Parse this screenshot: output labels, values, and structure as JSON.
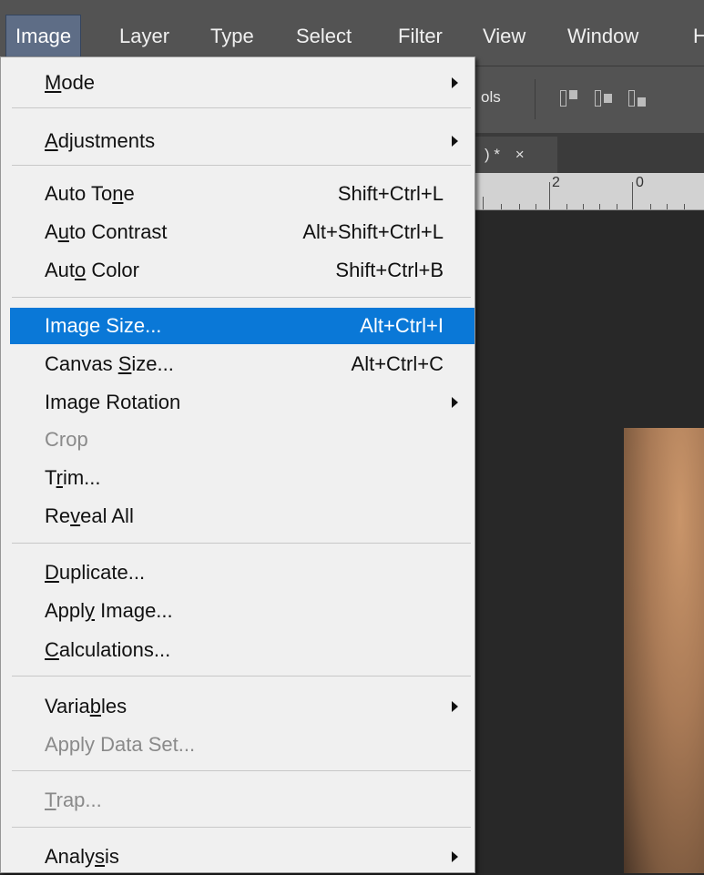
{
  "menubar": {
    "items": [
      {
        "label": "Image",
        "active": true
      },
      {
        "label": "Layer"
      },
      {
        "label": "Type"
      },
      {
        "label": "Select"
      },
      {
        "label": "Filter"
      },
      {
        "label": "View"
      },
      {
        "label": "Window"
      },
      {
        "label": "H"
      }
    ]
  },
  "workspace": {
    "options_text": "ols",
    "doc_tab_text": ") *",
    "doc_tab_close": "×",
    "ruler_labels": [
      "2",
      "0"
    ]
  },
  "image_menu": {
    "items": [
      {
        "label": "Mode",
        "mnemonic": "M",
        "submenu": true
      },
      {
        "label": "Adjustments",
        "mnemonic": "A",
        "submenu": true
      },
      {
        "label": "Auto Tone",
        "mnemonic": "n",
        "shortcut": "Shift+Ctrl+L"
      },
      {
        "label": "Auto Contrast",
        "mnemonic": "u",
        "shortcut": "Alt+Shift+Ctrl+L"
      },
      {
        "label": "Auto Color",
        "mnemonic": "o",
        "shortcut": "Shift+Ctrl+B"
      },
      {
        "label": "Image Size...",
        "mnemonic": "g",
        "shortcut": "Alt+Ctrl+I",
        "highlighted": true
      },
      {
        "label": "Canvas Size...",
        "mnemonic": "S",
        "shortcut": "Alt+Ctrl+C"
      },
      {
        "label": "Image Rotation",
        "mnemonic": "",
        "submenu": true
      },
      {
        "label": "Crop",
        "mnemonic": "",
        "disabled": true
      },
      {
        "label": "Trim...",
        "mnemonic": "r"
      },
      {
        "label": "Reveal All",
        "mnemonic": "v"
      },
      {
        "label": "Duplicate...",
        "mnemonic": "D"
      },
      {
        "label": "Apply Image...",
        "mnemonic": "y"
      },
      {
        "label": "Calculations...",
        "mnemonic": "C"
      },
      {
        "label": "Variables",
        "mnemonic": "b",
        "submenu": true
      },
      {
        "label": "Apply Data Set...",
        "mnemonic": "",
        "disabled": true
      },
      {
        "label": "Trap...",
        "mnemonic": "T",
        "disabled": true
      },
      {
        "label": "Analysis",
        "mnemonic": "s",
        "submenu": true
      }
    ]
  },
  "colors": {
    "menubar_bg": "#535353",
    "menu_bg": "#f0f0f0",
    "highlight": "#0a78d7",
    "disabled_text": "#8a8a8a"
  }
}
